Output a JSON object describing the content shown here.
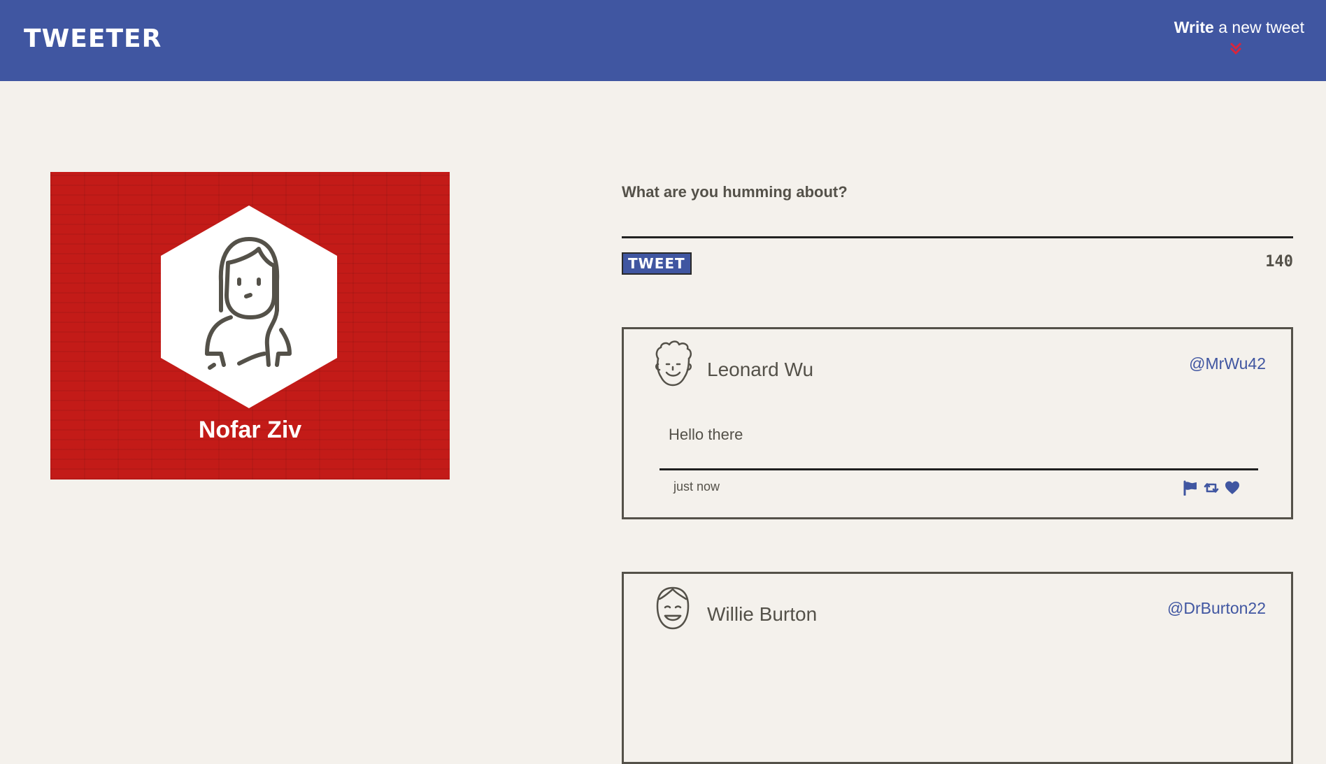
{
  "header": {
    "logo": "TWEETER",
    "compose_bold": "Write",
    "compose_rest": " a new tweet",
    "compose_icon": "double-chevron-down-icon"
  },
  "profile": {
    "name": "Nofar Ziv",
    "avatar_icon": "woman-avatar-icon",
    "background_color": "#c31b18"
  },
  "compose": {
    "prompt": "What are you humming about?",
    "textarea_value": "",
    "submit_label": "TWEET",
    "counter": "140"
  },
  "tweets": [
    {
      "author": "Leonard Wu",
      "handle": "@MrWu42",
      "content": "Hello there",
      "timestamp": "just now",
      "avatar_icon": "curly-hair-avatar-icon",
      "actions": [
        "flag-icon",
        "retweet-icon",
        "heart-icon"
      ]
    },
    {
      "author": "Willie Burton",
      "handle": "@DrBurton22",
      "avatar_icon": "smiling-avatar-icon"
    }
  ],
  "colors": {
    "brand_blue": "#4056a1",
    "accent_red": "#d7263d",
    "background": "#f4f1ec",
    "text": "#545149"
  }
}
